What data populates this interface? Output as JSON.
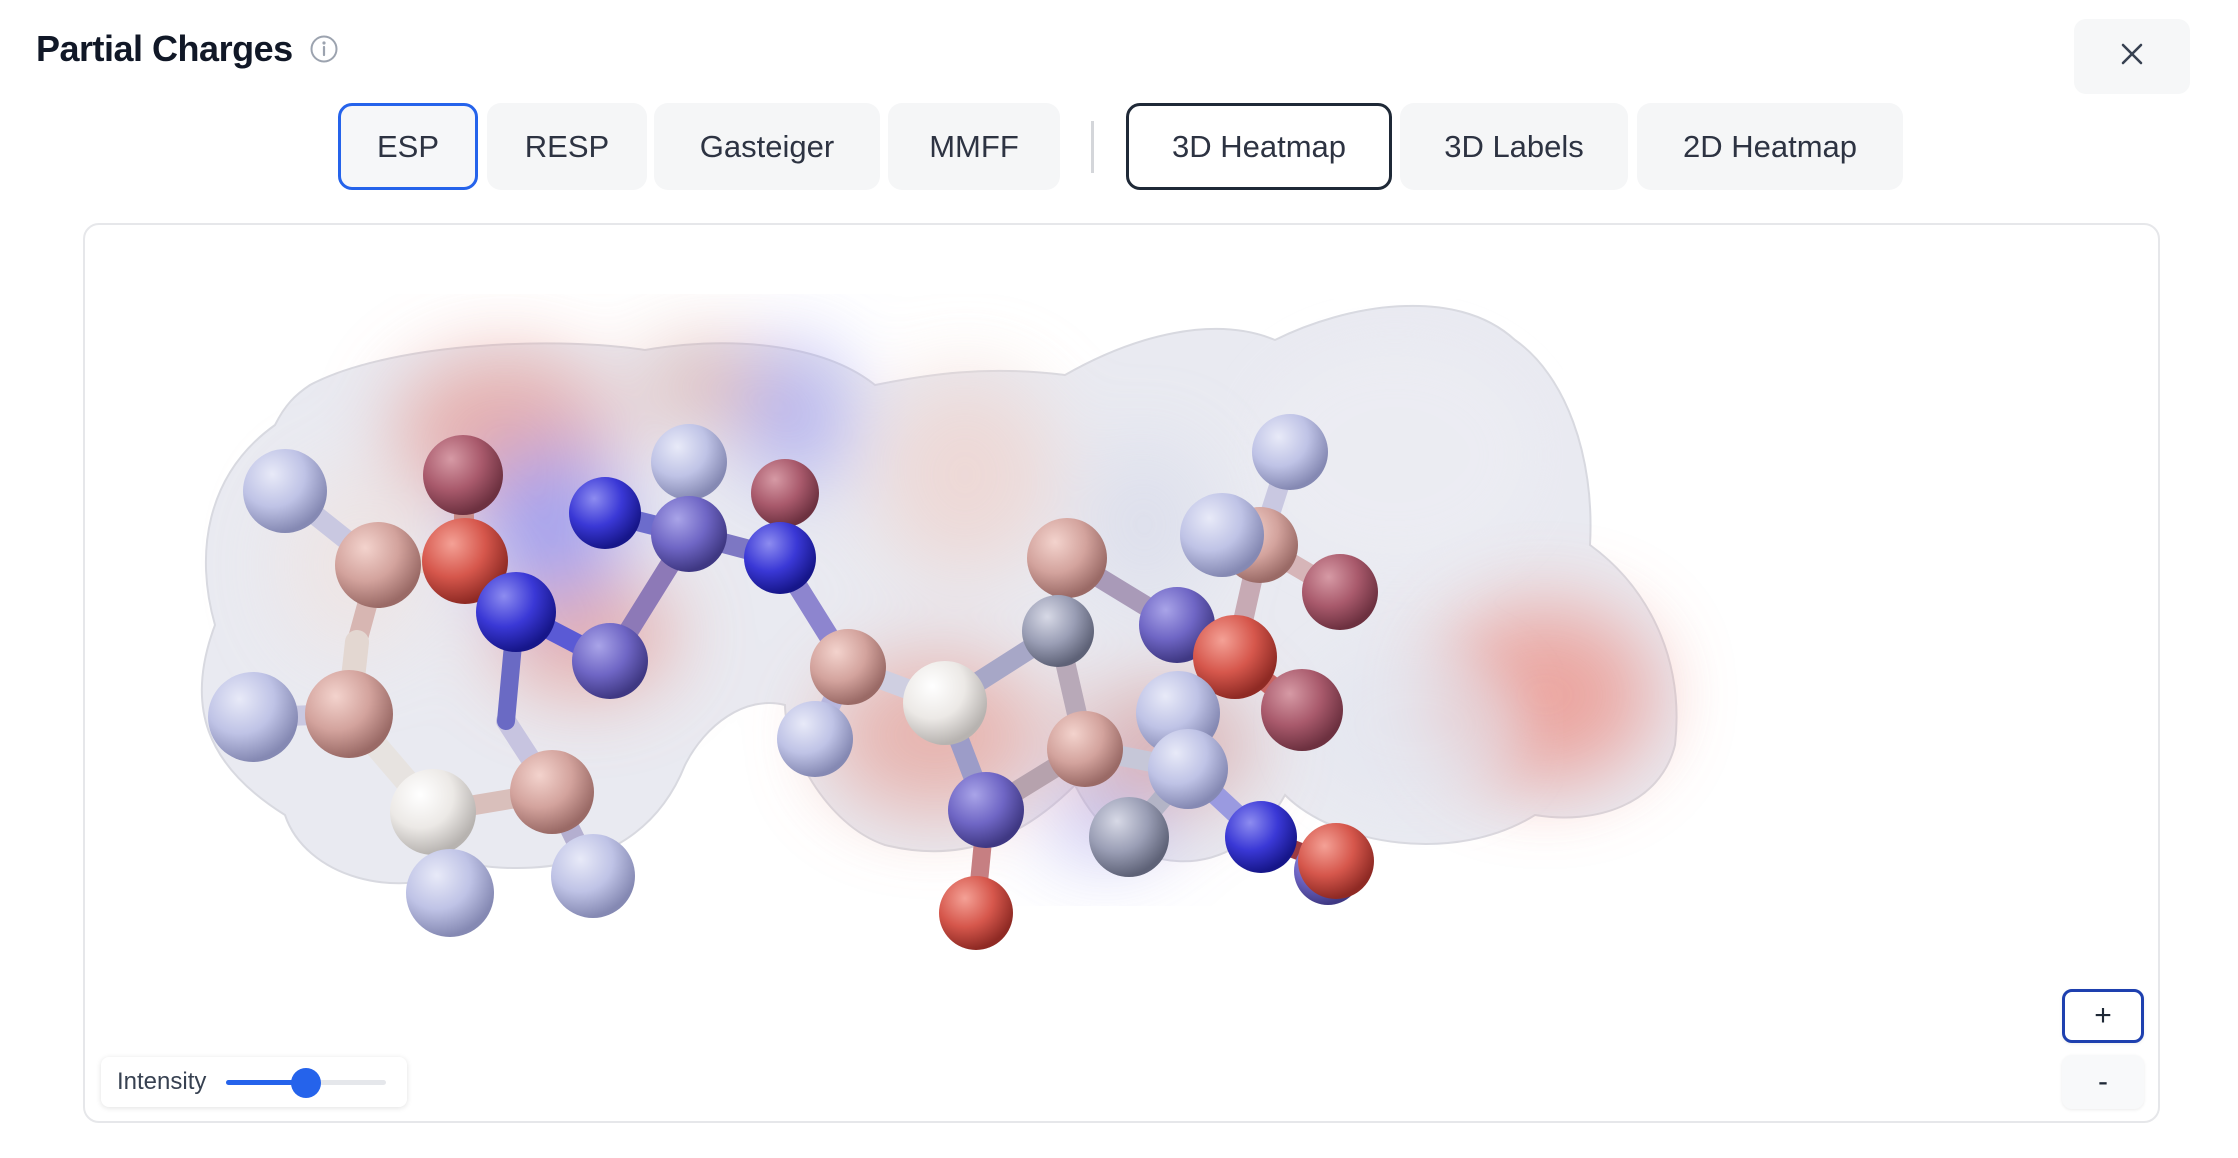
{
  "header": {
    "title": "Partial Charges",
    "info_icon": "info-circle-icon",
    "close_icon": "close-icon"
  },
  "methods": [
    {
      "label": "ESP",
      "active": true
    },
    {
      "label": "RESP",
      "active": false
    },
    {
      "label": "Gasteiger",
      "active": false
    },
    {
      "label": "MMFF",
      "active": false
    }
  ],
  "views": [
    {
      "label": "3D Heatmap",
      "active": true
    },
    {
      "label": "3D Labels",
      "active": false
    },
    {
      "label": "2D Heatmap",
      "active": false
    }
  ],
  "viewer": {
    "intensity_label": "Intensity",
    "intensity_value": 0.5,
    "zoom_in_label": "+",
    "zoom_out_label": "-"
  },
  "colors": {
    "accent": "#2563eb",
    "positive_charge": "#e0544a",
    "negative_charge": "#2626d6",
    "neutral": "#f3f1ee"
  }
}
